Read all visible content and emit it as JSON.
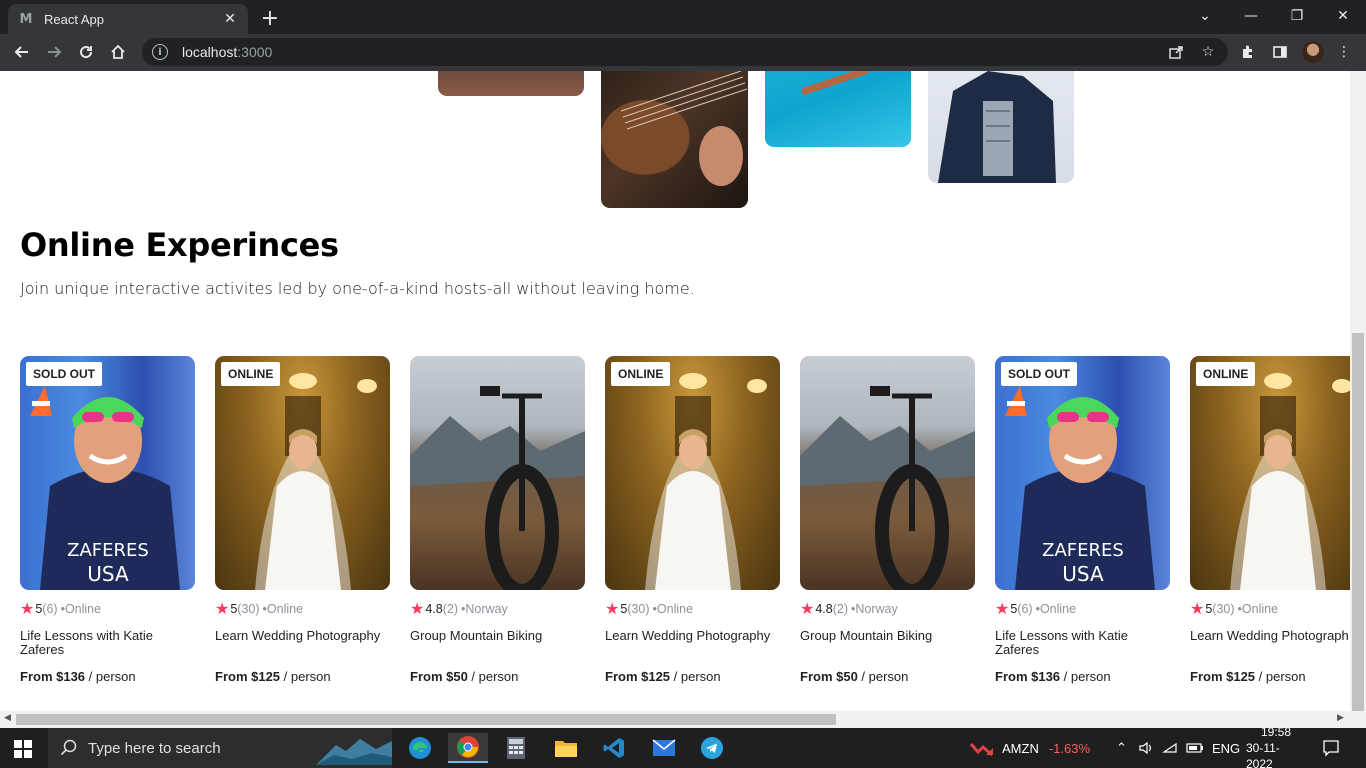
{
  "browser": {
    "tab_title": "React App",
    "tab_close": "✕",
    "new_tab": "+",
    "url_host": "localhost",
    "url_port": ":3000",
    "window_controls": {
      "minimize": "—",
      "restore": "❐",
      "close": "✕",
      "tab_list": "⌄"
    }
  },
  "page": {
    "section_title": "Online Experinces",
    "section_subtitle": "Join unique interactive activites led by one-of-a-kind hosts-all without leaving home."
  },
  "cards": [
    {
      "badge": "SOLD OUT",
      "rating": "5",
      "count": "(6)",
      "location": "•Online",
      "title": "Life Lessons with Katie Zaferes",
      "price_bold": "From $136",
      "price_rest": " / person",
      "image": "swimmer"
    },
    {
      "badge": "ONLINE",
      "rating": "5",
      "count": "(30)",
      "location": "•Online",
      "title": "Learn Wedding Photography",
      "price_bold": "From $125",
      "price_rest": " / person",
      "image": "bride"
    },
    {
      "badge": "",
      "rating": "4.8",
      "count": "(2)",
      "location": "•Norway",
      "title": "Group Mountain Biking",
      "price_bold": "From $50",
      "price_rest": " / person",
      "image": "bike"
    },
    {
      "badge": "ONLINE",
      "rating": "5",
      "count": "(30)",
      "location": "•Online",
      "title": "Learn Wedding Photography",
      "price_bold": "From $125",
      "price_rest": " / person",
      "image": "bride"
    },
    {
      "badge": "",
      "rating": "4.8",
      "count": "(2)",
      "location": "•Norway",
      "title": "Group Mountain Biking",
      "price_bold": "From $50",
      "price_rest": " / person",
      "image": "bike"
    },
    {
      "badge": "SOLD OUT",
      "rating": "5",
      "count": "(6)",
      "location": "•Online",
      "title": "Life Lessons with Katie Zaferes",
      "price_bold": "From $136",
      "price_rest": " / person",
      "image": "swimmer"
    },
    {
      "badge": "ONLINE",
      "rating": "5",
      "count": "(30)",
      "location": "•Online",
      "title": "Learn Wedding Photograph",
      "price_bold": "From $125",
      "price_rest": " / person",
      "image": "bride"
    }
  ],
  "taskbar": {
    "search_placeholder": "Type here to search",
    "stock_ticker": "AMZN",
    "stock_change": "-1.63%",
    "language": "ENG",
    "time": "19:58",
    "date": "30-11-2022"
  },
  "colors": {
    "star": "#fe395c",
    "stock_negative": "#ff5c5c",
    "chrome_dark": "#202124",
    "chrome_toolbar": "#35363a"
  }
}
